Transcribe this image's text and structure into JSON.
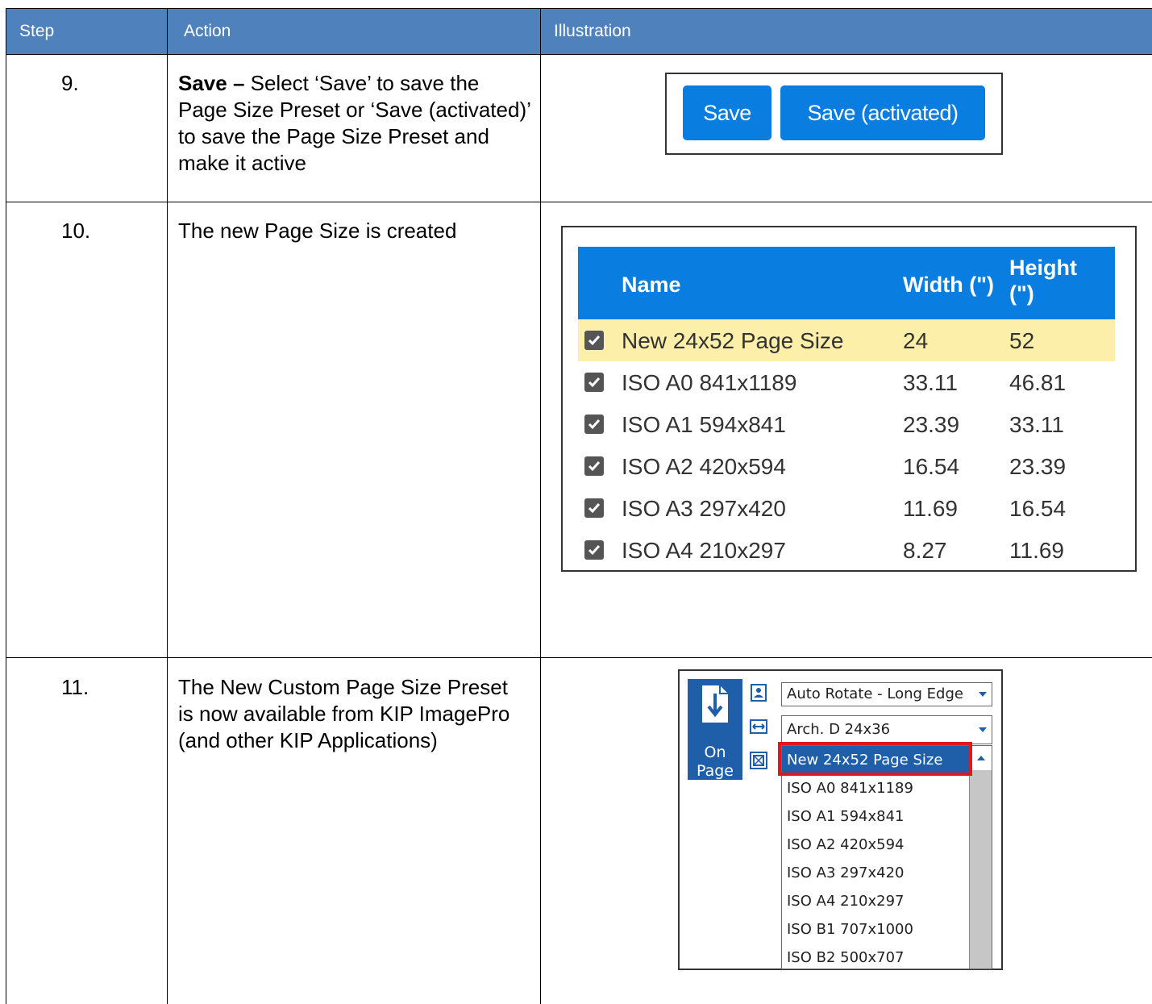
{
  "header": {
    "step": "Step",
    "action": "Action",
    "illustration": "Illustration"
  },
  "rows": [
    {
      "step": "9.",
      "action_bold": "Save –",
      "action_text": " Select ‘Save’ to save the Page Size Preset or ‘Save (activated)’ to save the Page Size Preset and make it active",
      "buttons": {
        "save": "Save",
        "save_activated": "Save (activated)"
      }
    },
    {
      "step": "10.",
      "action_text": "The new Page Size is created",
      "table": {
        "columns": [
          "Name",
          "Width (\")",
          "Height (\")"
        ],
        "rows": [
          {
            "name": "New 24x52 Page Size",
            "width": "24",
            "height": "52",
            "checked": true,
            "highlighted": true
          },
          {
            "name": "ISO A0 841x1189",
            "width": "33.11",
            "height": "46.81",
            "checked": true
          },
          {
            "name": "ISO A1 594x841",
            "width": "23.39",
            "height": "33.11",
            "checked": true
          },
          {
            "name": "ISO A2 420x594",
            "width": "16.54",
            "height": "23.39",
            "checked": true
          },
          {
            "name": "ISO A3 297x420",
            "width": "11.69",
            "height": "16.54",
            "checked": true
          },
          {
            "name": "ISO A4 210x297",
            "width": "8.27",
            "height": "11.69",
            "checked": true
          }
        ]
      }
    },
    {
      "step": "11.",
      "action_text": "The New Custom Page Size Preset is now available from KIP ImagePro (and other KIP Applications)",
      "kip": {
        "on_page_line1": "On",
        "on_page_line2": "Page",
        "rotate_value": "Auto Rotate - Long Edge",
        "size_value": "Arch. D 24x36",
        "options": [
          "New 24x52 Page Size",
          "ISO A0 841x1189",
          "ISO A1 594x841",
          "ISO A2 420x594",
          "ISO A3 297x420",
          "ISO A4 210x297",
          "ISO B1 707x1000",
          "ISO B2 500x707"
        ],
        "selected_index": 0
      }
    }
  ],
  "colors": {
    "header_bg": "#4f81bd",
    "button_blue": "#0a7de0",
    "highlight_row": "#fbefaa",
    "kip_blue": "#1f5ea8",
    "callout_red": "#e3161a"
  }
}
